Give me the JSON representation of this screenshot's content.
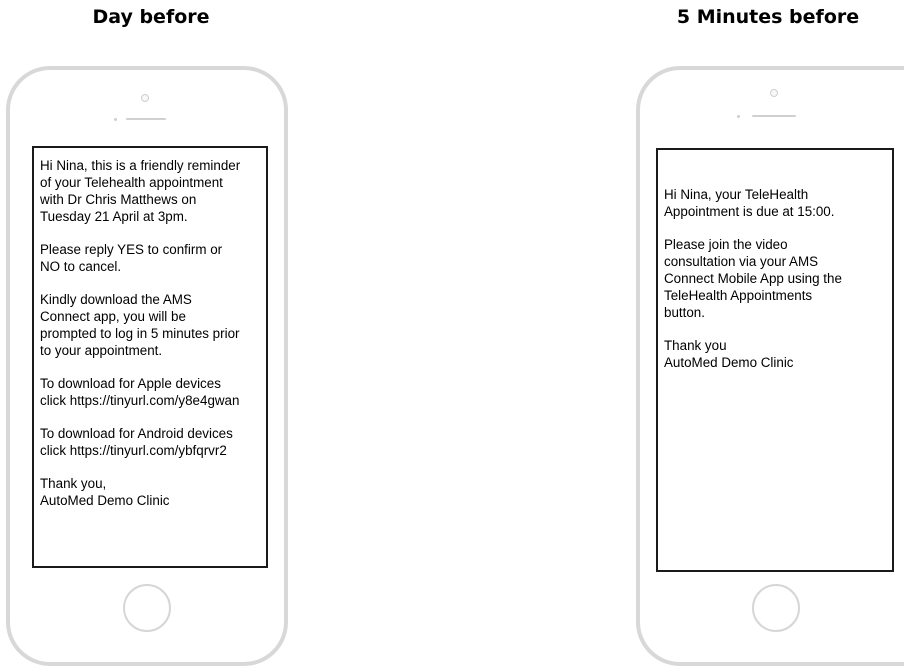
{
  "headings": {
    "left": "Day before",
    "right": "5 Minutes before"
  },
  "messages": {
    "day_before": {
      "paragraphs": [
        "Hi Nina, this is a friendly reminder\nof your Telehealth appointment\nwith Dr Chris Matthews on\nTuesday 21 April at 3pm.",
        "Please reply YES to confirm or\nNO to cancel.",
        "Kindly download the AMS\nConnect app, you will be\nprompted to log in 5 minutes prior\nto your appointment.",
        "To download for Apple devices\nclick https://tinyurl.com/y8e4gwan",
        "To download for Android devices\nclick https://tinyurl.com/ybfqrvr2",
        "Thank you,\nAutoMed Demo Clinic"
      ]
    },
    "five_minutes_before": {
      "paragraphs": [
        "Hi Nina, your TeleHealth\nAppointment is due at 15:00.",
        "Please join the video\nconsultation via your AMS\nConnect Mobile App using the\nTeleHealth Appointments\nbutton.",
        "Thank you\nAutoMed Demo Clinic"
      ]
    }
  },
  "colors": {
    "phone_frame": "#d8d8d8",
    "screen_border": "#1a1a1a",
    "background": "#ffffff",
    "text": "#000000"
  }
}
